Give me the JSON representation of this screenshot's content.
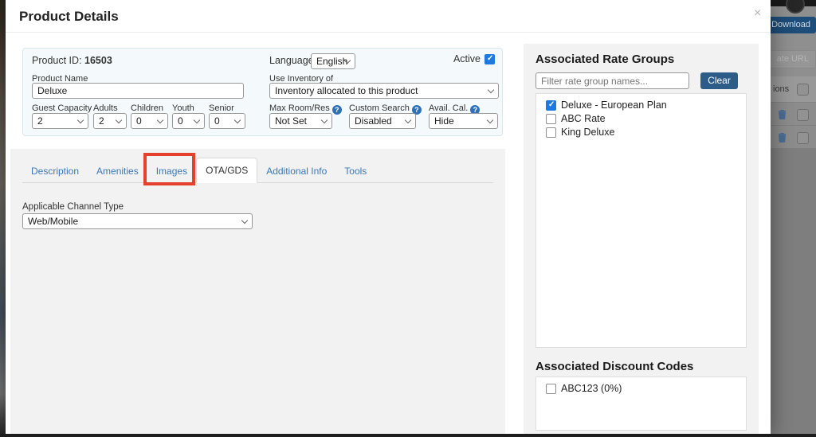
{
  "modal": {
    "title": "Product Details",
    "close_icon": "×",
    "product": {
      "id_label": "Product ID:",
      "id_value": "16503",
      "language_label": "Language:",
      "language_value": "English",
      "active_label": "Active",
      "active_checked": true,
      "name_label": "Product Name",
      "name_value": "Deluxe",
      "inventory_label": "Use Inventory of",
      "inventory_value": "Inventory allocated to this product",
      "capacity_fields": [
        {
          "label": "Guest Capacity",
          "value": "2"
        },
        {
          "label": "Adults",
          "value": "2"
        },
        {
          "label": "Children",
          "value": "0"
        },
        {
          "label": "Youth",
          "value": "0"
        },
        {
          "label": "Senior",
          "value": "0"
        }
      ],
      "option_fields": [
        {
          "label": "Max Room/Res",
          "value": "Not Set",
          "help_glyph": "?"
        },
        {
          "label": "Custom Search",
          "value": "Disabled",
          "help_glyph": "?"
        },
        {
          "label": "Avail. Cal.",
          "value": "Hide",
          "help_glyph": "?"
        }
      ]
    },
    "tabs": [
      {
        "label": "Description",
        "active": false
      },
      {
        "label": "Amenities",
        "active": false
      },
      {
        "label": "Images",
        "active": false
      },
      {
        "label": "OTA/GDS",
        "active": true
      },
      {
        "label": "Additional Info",
        "active": false
      },
      {
        "label": "Tools",
        "active": false
      }
    ],
    "channel": {
      "label": "Applicable Channel Type",
      "value": "Web/Mobile"
    }
  },
  "rate_groups": {
    "title": "Associated Rate Groups",
    "filter_placeholder": "Filter rate group names...",
    "clear_label": "Clear",
    "items": [
      {
        "label": "Deluxe - European Plan",
        "checked": true
      },
      {
        "label": "ABC Rate",
        "checked": false
      },
      {
        "label": "King Deluxe",
        "checked": false
      }
    ]
  },
  "discount_codes": {
    "title": "Associated Discount Codes",
    "items": [
      {
        "label": "ABC123 (0%)",
        "checked": false
      }
    ]
  },
  "background": {
    "download_label": "Download",
    "url_button_label": "ate URL",
    "actions_label": "ions"
  },
  "colors": {
    "tab_link_blue": "#3b78b5",
    "clear_button": "#2e5c88",
    "download_button": "#1d4d78",
    "annotation_red": "#e5402c",
    "checkbox_checked": "#1f7ae0",
    "info_panel_bg": "#f4fafc",
    "section_bg": "#f2f2f2"
  }
}
